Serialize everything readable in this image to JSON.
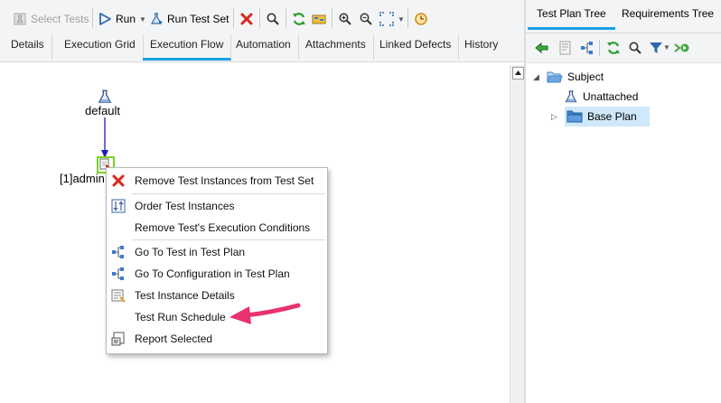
{
  "toolbar": {
    "select_tests": "Select Tests",
    "run": "Run",
    "run_test_set": "Run Test Set"
  },
  "tabs": [
    {
      "label": "Details"
    },
    {
      "label": "Execution Grid"
    },
    {
      "label": "Execution Flow"
    },
    {
      "label": "Automation"
    },
    {
      "label": "Attachments"
    },
    {
      "label": "Linked Defects"
    },
    {
      "label": "History"
    }
  ],
  "flow": {
    "start_node_label": "default",
    "instance_label": "[1]admin"
  },
  "context_menu": {
    "items": [
      {
        "label": "Remove Test Instances from Test Set",
        "icon": "red-x-icon"
      },
      {
        "label": "Order Test Instances",
        "icon": "order-icon"
      },
      {
        "label": "Remove Test's Execution Conditions",
        "icon": ""
      },
      {
        "label": "Go To Test in Test Plan",
        "icon": "goto-tree-icon"
      },
      {
        "label": "Go To Configuration in Test Plan",
        "icon": "goto-tree-icon"
      },
      {
        "label": "Test Instance Details",
        "icon": "details-icon"
      },
      {
        "label": "Test Run Schedule",
        "icon": ""
      },
      {
        "label": "Report Selected",
        "icon": "report-icon"
      }
    ]
  },
  "right_panel": {
    "tabs": [
      {
        "label": "Test Plan Tree"
      },
      {
        "label": "Requirements Tree"
      }
    ],
    "tree": [
      {
        "label": "Subject"
      },
      {
        "label": "Unattached"
      },
      {
        "label": "Base Plan"
      }
    ]
  },
  "colors": {
    "accent": "#1aa0e6",
    "arrow_annotation": "#e8336e",
    "selected_row": "#cfe8fb",
    "folder": "#3f84c8",
    "refresh_green": "#2e9d2e",
    "delete_red": "#d9261c"
  }
}
